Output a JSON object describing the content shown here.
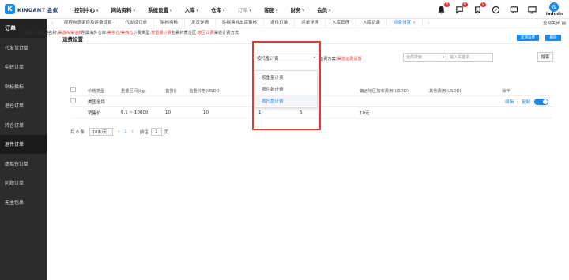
{
  "brand": {
    "mark": "K",
    "name": "KINGANT 金蚁"
  },
  "nav": [
    {
      "label": "控制中心",
      "caret": "▾",
      "active": false
    },
    {
      "label": "网站资料",
      "caret": "▾",
      "active": false
    },
    {
      "label": "系统设置",
      "caret": "▾",
      "active": false
    },
    {
      "label": "入库",
      "caret": "▾",
      "active": false
    },
    {
      "label": "仓库",
      "caret": "▾",
      "active": false
    },
    {
      "label": "订单",
      "caret": "▾",
      "active": true
    },
    {
      "label": "客服",
      "caret": "▾",
      "active": false
    },
    {
      "label": "财务",
      "caret": "▾",
      "active": false
    },
    {
      "label": "会员",
      "caret": "▾",
      "active": false
    }
  ],
  "top_icons": [
    {
      "name": "bell-icon",
      "badge": "9"
    },
    {
      "name": "message-icon",
      "badge": "8"
    },
    {
      "name": "notice-icon",
      "badge": "0"
    },
    {
      "name": "compass-icon",
      "badge": ""
    },
    {
      "name": "chat-icon",
      "badge": ""
    },
    {
      "name": "monitor-icon",
      "badge": ""
    }
  ],
  "user": {
    "avatar": "&",
    "name": "iadmin"
  },
  "sidebar": {
    "header": "订单",
    "items": [
      {
        "label": "代发货订单",
        "active": false
      },
      {
        "label": "中转订单",
        "active": false
      },
      {
        "label": "贴标换标",
        "active": false
      },
      {
        "label": "退仓订单",
        "active": false
      },
      {
        "label": "转仓订单",
        "active": false
      },
      {
        "label": "退件订单",
        "active": true
      },
      {
        "label": "虚拟仓订单",
        "active": false
      },
      {
        "label": "问题订单",
        "active": false
      },
      {
        "label": "无主包裹",
        "active": false
      }
    ]
  },
  "tabs": {
    "left_arrow": "‹",
    "items": [
      {
        "label": "尾程物流渠道及运费设置",
        "active": false
      },
      {
        "label": "代发货订单",
        "active": false
      },
      {
        "label": "贴标换标",
        "active": false
      },
      {
        "label": "发货详情",
        "active": false
      },
      {
        "label": "贴标换标出库审核",
        "active": false
      },
      {
        "label": "退件订单",
        "active": false
      },
      {
        "label": "运单详情",
        "active": false
      },
      {
        "label": "入库管理",
        "active": false
      },
      {
        "label": "入库记录",
        "active": false
      },
      {
        "label": "运费设置",
        "active": true,
        "close": "×"
      }
    ],
    "right_arrow": "›",
    "right_text": "全部关闭 ▤"
  },
  "page": {
    "title": "运费设置",
    "add_button": "新增运费",
    "delete_button": "删除"
  },
  "filter": {
    "prefix": "尾程派送渠道名称:",
    "channel": "渠道A/渠道B",
    "mid": "所属海外仓库:",
    "warehouse": "美东仓/美西仓",
    "billing_type_label": "计费类型:",
    "billing_type": "按重量计费",
    "area_label": "包裹材质分区:",
    "area": "按区计费",
    "method_label": "渠道计费方式:",
    "select_value": "按托盘计费",
    "select_arrow": "▾",
    "fee_label": "运费方案:",
    "fee_value": "渠道运费设置",
    "search_left": "全局搜索",
    "search_right_caret": "▾",
    "search_placeholder": "输入关键字",
    "search_button": "搜索"
  },
  "dropdown": {
    "options": [
      {
        "label": "按重量计费",
        "selected": false
      },
      {
        "label": "按件数计费",
        "selected": false
      },
      {
        "label": "按托盘计费",
        "selected": true
      }
    ]
  },
  "table": {
    "headers": [
      "价格类型",
      "重量区间(kg)",
      "首重()",
      "首重价格(USDD)",
      "",
      "",
      "偏远地区加收费用(USDD)",
      "其他费用(USDD)",
      "操作"
    ],
    "group_row": {
      "label": "美国全境",
      "edit": "编辑",
      "sep": "|",
      "copy": "复制"
    },
    "rows": [
      {
        "type": "销售价",
        "range": "0.1 ~ 10000",
        "first": "10",
        "price": "10",
        "col5": "1",
        "col6": "5",
        "remote": "10元",
        "other": ""
      }
    ]
  },
  "pager": {
    "total": "共 0 条",
    "page_size": "10条/页",
    "prev": "‹",
    "current": "1",
    "next": "›",
    "goto": "前往",
    "goto_value": "1",
    "unit": "页"
  },
  "colors": {
    "accent": "#1e88e5",
    "highlight": "#e53935",
    "sidebar": "#2c2c2c"
  }
}
